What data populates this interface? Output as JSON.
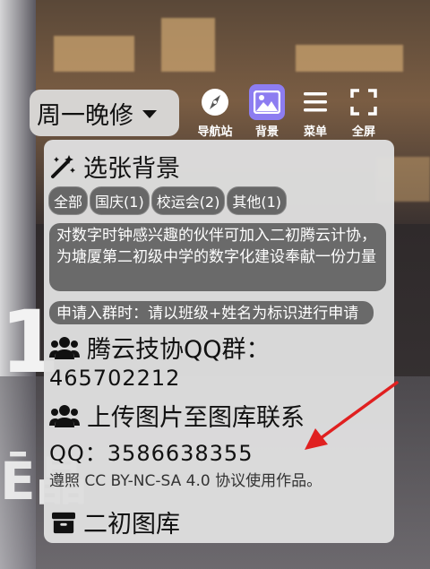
{
  "background": {
    "big_digit": "1",
    "big_glyphs": "Ē晶"
  },
  "topbar": {
    "schedule_label": "周一晚修",
    "tools": [
      {
        "label": "导航站",
        "icon": "compass-icon"
      },
      {
        "label": "背景",
        "icon": "image-icon",
        "active": true
      },
      {
        "label": "菜单",
        "icon": "menu-icon"
      },
      {
        "label": "全屏",
        "icon": "fullscreen-icon"
      }
    ]
  },
  "panel": {
    "title": "选张背景",
    "chips": [
      "全部",
      "国庆(1)",
      "校运会(2)",
      "其他(1)"
    ],
    "notice1": "对数字时钟感兴趣的伙伴可加入二初腾云计协，为塘厦第二初级中学的数字化建设奉献一份力量",
    "notice2": "申请入群时：请以班级+姓名为标识进行申请",
    "qq_group_title": "腾云技协QQ群：",
    "qq_group_number": "465702212",
    "upload_title": "上传图片至图库联系",
    "upload_qq": "QQ：3586638355",
    "license": "遵照 CC BY-NC-SA 4.0 协议使用作品。",
    "gallery_title": "二初图库"
  },
  "colors": {
    "accent": "#8d7df1",
    "annotation_arrow": "#e02020",
    "chip_bg": "#676767",
    "panel_bg": "#dedede"
  }
}
